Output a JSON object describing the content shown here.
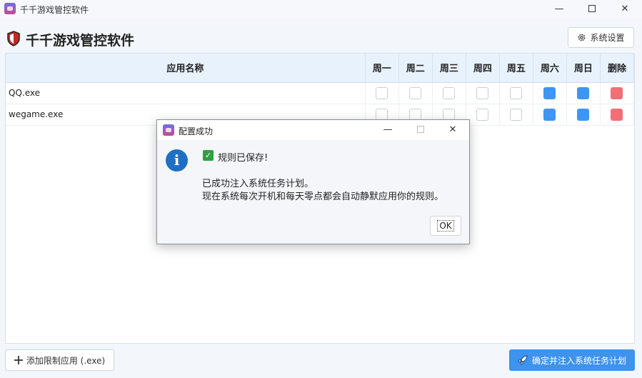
{
  "window": {
    "title": "千千游戏管控软件",
    "min": "—",
    "close": "✕"
  },
  "header": {
    "title": "千千游戏管控软件",
    "settings_label": "系统设置"
  },
  "table": {
    "headers": [
      "应用名称",
      "周一",
      "周二",
      "周三",
      "周四",
      "周五",
      "周六",
      "周日",
      "删除"
    ],
    "rows": [
      {
        "name": "QQ.exe",
        "days": [
          false,
          false,
          false,
          false,
          false,
          true,
          true
        ]
      },
      {
        "name": "wegame.exe",
        "days": [
          false,
          false,
          false,
          false,
          false,
          true,
          true
        ]
      }
    ]
  },
  "footer": {
    "add_label": "添加限制应用 (.exe)",
    "confirm_label": "确定并注入系统任务计划"
  },
  "dialog": {
    "title": "配置成功",
    "line1": "规则已保存!",
    "line2": "已成功注入系统任务计划。",
    "line3": "现在系统每次开机和每天零点都会自动静默应用你的规则。",
    "ok_label": "OK",
    "min": "—",
    "close": "✕"
  },
  "colors": {
    "accent": "#3e96f2",
    "delete": "#f07076",
    "header_bg": "#e8f2fc"
  }
}
